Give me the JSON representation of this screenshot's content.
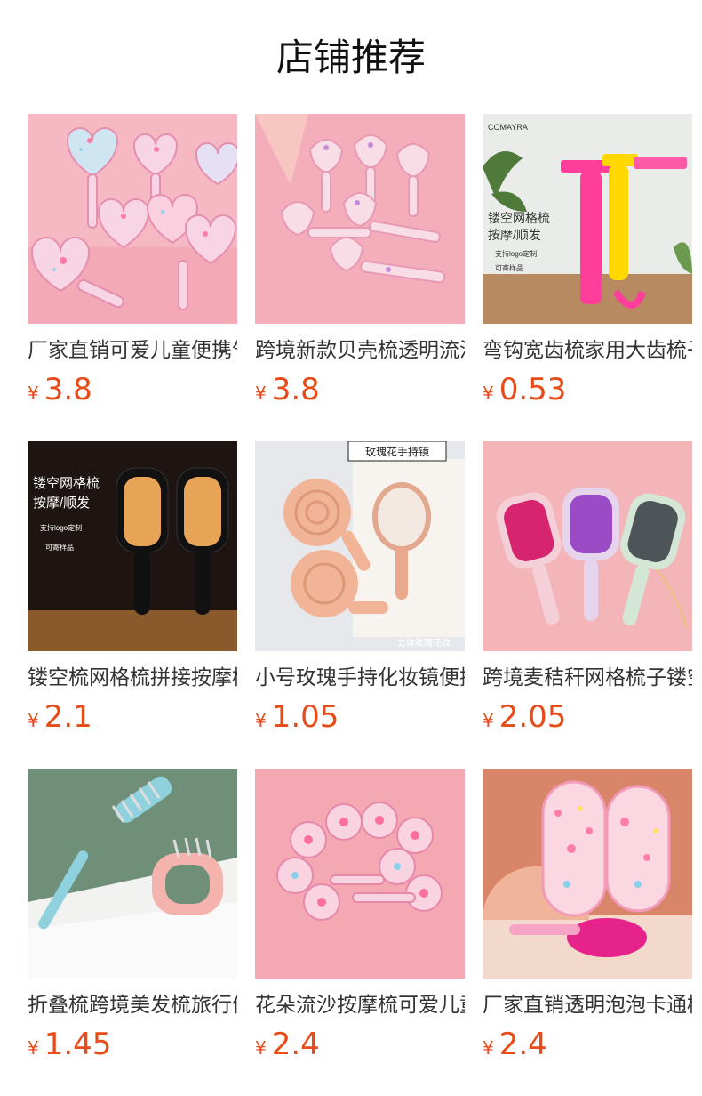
{
  "page": {
    "title": "店铺推荐"
  },
  "products": [
    {
      "name": "厂家直销可爱儿童便携气囊梳",
      "currency": "¥",
      "price": "3.8",
      "image": "heart-shaped-glitter-combs"
    },
    {
      "name": "跨境新款贝壳梳透明流沙梳",
      "currency": "¥",
      "price": "3.8",
      "image": "shell-shaped-glitter-combs"
    },
    {
      "name": "弯钩宽齿梳家用大齿梳子",
      "currency": "¥",
      "price": "0.53",
      "image": "hook-wide-tooth-combs",
      "overlay": {
        "brand": "COMAYRA",
        "headline": [
          "镂空网格梳",
          "按摩/顺发"
        ],
        "tags": [
          "支持logo定制",
          "可寄样品"
        ]
      }
    },
    {
      "name": "镂空梳网格梳拼接按摩梳",
      "currency": "¥",
      "price": "2.1",
      "image": "hollow-grid-brushes",
      "overlay": {
        "headline": [
          "镂空网格梳",
          "按摩/顺发"
        ],
        "tags": [
          "支持logo定制",
          "可寄样品"
        ]
      }
    },
    {
      "name": "小号玫瑰手持化妆镜便携",
      "currency": "¥",
      "price": "1.05",
      "image": "rose-hand-mirrors",
      "overlay": {
        "tag": "玫瑰花手持镜",
        "caption": "立体玫瑰花纹"
      }
    },
    {
      "name": "跨境麦秸秆网格梳子镂空",
      "currency": "¥",
      "price": "2.05",
      "image": "wheat-straw-grid-brushes"
    },
    {
      "name": "折叠梳跨境美发梳旅行便携",
      "currency": "¥",
      "price": "1.45",
      "image": "folding-combs"
    },
    {
      "name": "花朵流沙按摩梳可爱儿童",
      "currency": "¥",
      "price": "2.4",
      "image": "flower-glitter-brushes"
    },
    {
      "name": "厂家直销透明泡泡卡通梳",
      "currency": "¥",
      "price": "2.4",
      "image": "transparent-bubble-brushes"
    }
  ],
  "colors": {
    "price": "#e84b1a",
    "pink_bg": "#f5b8c0"
  }
}
